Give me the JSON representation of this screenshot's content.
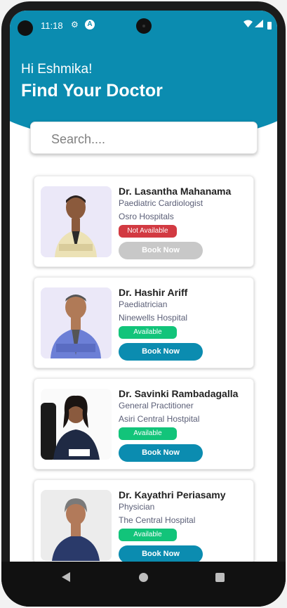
{
  "status_bar": {
    "time": "11:18",
    "gear_icon": "gear-icon",
    "auto_badge": "A"
  },
  "header": {
    "greeting": "Hi Eshmika!",
    "title": "Find Your Doctor"
  },
  "search": {
    "placeholder": "Search...."
  },
  "colors": {
    "brand": "#0b8cb0",
    "not_available": "#d23a42",
    "available": "#12c47a",
    "book_enabled": "#0b8cb0",
    "book_disabled": "#c8c8c8"
  },
  "doctors": [
    {
      "name": "Dr. Lasantha Mahanama",
      "specialty": "Paediatric Cardiologist",
      "hospital": "Osro Hospitals",
      "availability": "Not Available",
      "book_label": "Book Now"
    },
    {
      "name": "Dr. Hashir Ariff",
      "specialty": "Paediatrician",
      "hospital": "Ninewells Hospital",
      "availability": "Available",
      "book_label": "Book Now"
    },
    {
      "name": "Dr. Savinki Rambadagalla",
      "specialty": "General Practitioner",
      "hospital": "Asiri Central Hostpital",
      "availability": "Available",
      "book_label": "Book Now"
    },
    {
      "name": "Dr. Kayathri Periasamy",
      "specialty": "Physician",
      "hospital": "The Central Hospital",
      "availability": "Available",
      "book_label": "Book Now"
    }
  ]
}
